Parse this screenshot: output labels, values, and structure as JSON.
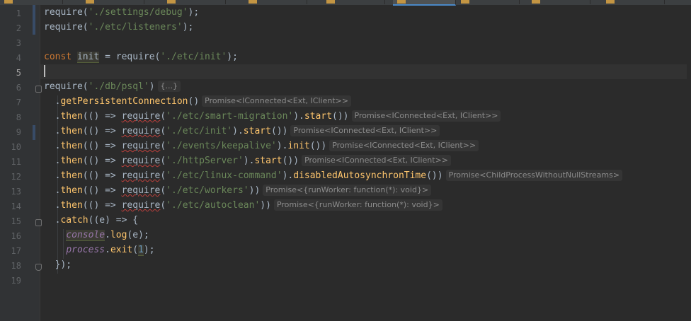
{
  "tab_count": 9,
  "colors": {
    "keyword": "#cc7832",
    "string": "#6a8759",
    "function": "#ffc66d",
    "number": "#6897bb",
    "global": "#9876aa",
    "text": "#a9b7c6",
    "hint": "#8c8c8c",
    "background": "#2b2b2b"
  },
  "gutter": {
    "line_numbers": [
      "1",
      "2",
      "3",
      "4",
      "5",
      "6",
      "7",
      "8",
      "9",
      "10",
      "11",
      "12",
      "13",
      "14",
      "15",
      "16",
      "17",
      "18",
      "19"
    ]
  },
  "code": {
    "l1": {
      "kw": "require",
      "p1": "(",
      "s": "'./settings/debug'",
      "p2": ");"
    },
    "l2": {
      "kw": "require",
      "p1": "(",
      "s": "'./etc/listeners'",
      "p2": ");"
    },
    "l4": {
      "const": "const",
      "sp": " ",
      "var": "init",
      "eq": " = require(",
      "s": "'./etc/init'",
      "end": ");"
    },
    "l6": {
      "a": "require(",
      "s": "'./db/psql'",
      "b": ")",
      "hint": "{...}"
    },
    "l7": {
      "dot": ".",
      "fn": "getPersistentConnection",
      "p": "()",
      "hint": "Promise<IConnected<Ext, IClient>>"
    },
    "l8": {
      "dot": ".",
      "fn": "then",
      "arrow": "(() => ",
      "req": "require",
      "p1": "(",
      "s": "'./etc/smart-migration'",
      "p2": ").",
      "m": "start",
      "p3": "())",
      "hint": "Promise<IConnected<Ext, IClient>>"
    },
    "l9": {
      "dot": ".",
      "fn": "then",
      "arrow": "(() => ",
      "req": "require",
      "p1": "(",
      "s": "'./etc/init'",
      "p2": ").",
      "m": "start",
      "p3": "())",
      "hint": "Promise<IConnected<Ext, IClient>>"
    },
    "l10": {
      "dot": ".",
      "fn": "then",
      "arrow": "(() => ",
      "req": "require",
      "p1": "(",
      "s": "'./events/keepalive'",
      "p2": ").",
      "m": "init",
      "p3": "())",
      "hint": "Promise<IConnected<Ext, IClient>>"
    },
    "l11": {
      "dot": ".",
      "fn": "then",
      "arrow": "(() => ",
      "req": "require",
      "p1": "(",
      "s": "'./httpServer'",
      "p2": ").",
      "m": "start",
      "p3": "())",
      "hint": "Promise<IConnected<Ext, IClient>>"
    },
    "l12": {
      "dot": ".",
      "fn": "then",
      "arrow": "(() => ",
      "req": "require",
      "p1": "(",
      "s": "'./etc/linux-command'",
      "p2": ").",
      "m": "disabledAutosynchronTime",
      "p3": "())",
      "hint": "Promise<ChildProcessWithoutNullStreams>"
    },
    "l13": {
      "dot": ".",
      "fn": "then",
      "arrow": "(() => ",
      "req": "require",
      "p1": "(",
      "s": "'./etc/workers'",
      "p3": "))",
      "hint": "Promise<{runWorker: function(*): void}>"
    },
    "l14": {
      "dot": ".",
      "fn": "then",
      "arrow": "(() => ",
      "req": "require",
      "p1": "(",
      "s": "'./etc/autoclean'",
      "p3": "))",
      "hint": "Promise<{runWorker: function(*): void}>"
    },
    "l15": {
      "dot": ".",
      "fn": "catch",
      "rest": "((e) => {"
    },
    "l16": {
      "obj": "console",
      "dot": ".",
      "m": "log",
      "rest": "(e);"
    },
    "l17": {
      "obj": "process",
      "dot": ".",
      "m": "exit",
      "p1": "(",
      "n": "1",
      "p2": ");"
    },
    "l18": {
      "rest": "});"
    }
  }
}
